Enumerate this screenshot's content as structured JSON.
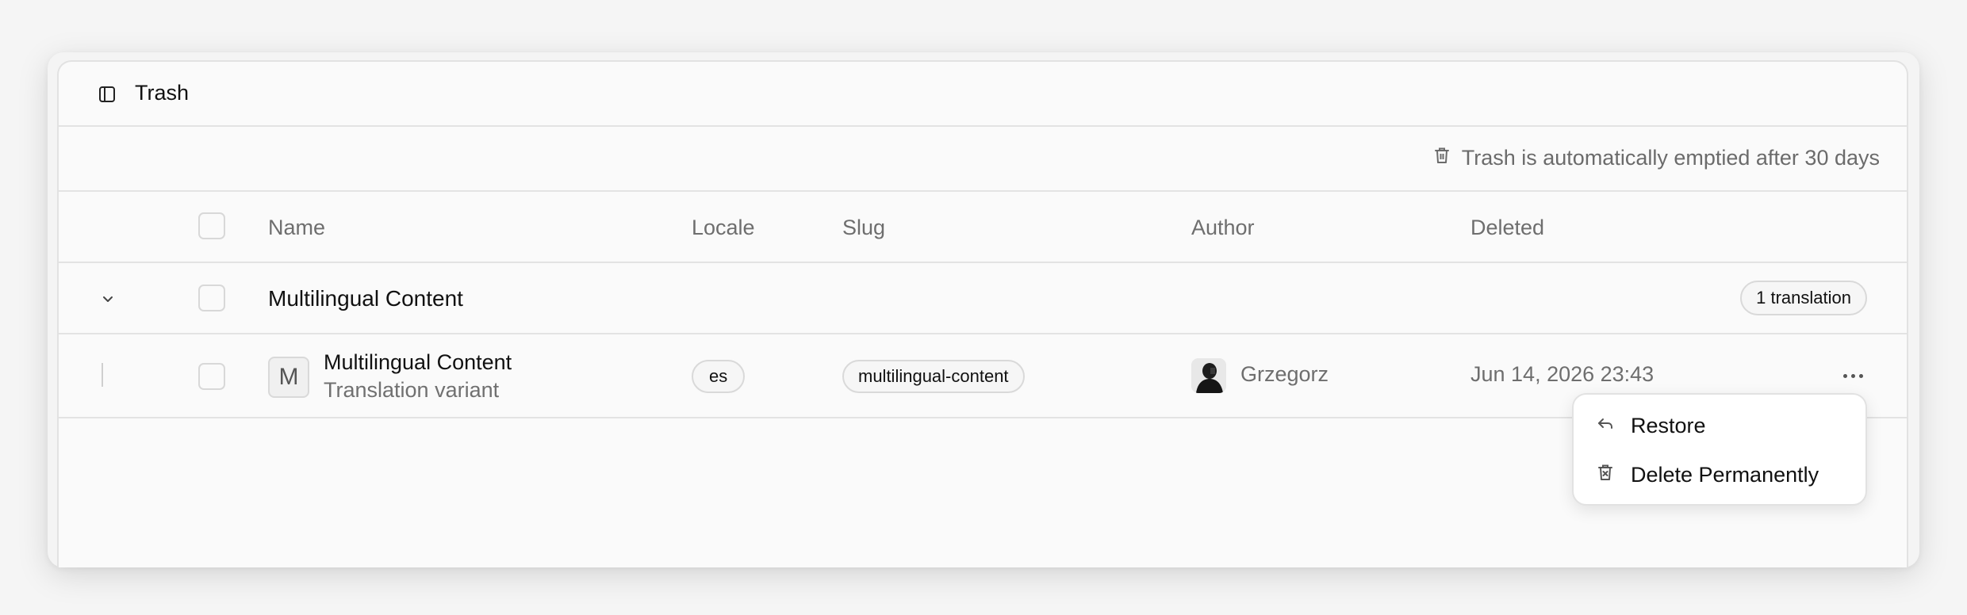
{
  "header": {
    "title": "Trash"
  },
  "notice": {
    "text": "Trash is automatically emptied after 30 days"
  },
  "table": {
    "columns": [
      "Name",
      "Locale",
      "Slug",
      "Author",
      "Deleted"
    ]
  },
  "group": {
    "name": "Multilingual Content",
    "badge": "1 translation"
  },
  "rows": [
    {
      "type_letter": "M",
      "title": "Multilingual Content",
      "subtitle": "Translation variant",
      "locale": "es",
      "slug": "multilingual-content",
      "author": "Grzegorz",
      "deleted": "Jun 14, 2026 23:43"
    }
  ],
  "context_menu": {
    "items": [
      {
        "label": "Restore",
        "icon": "undo-arrow-icon"
      },
      {
        "label": "Delete Permanently",
        "icon": "trash-x-icon"
      }
    ]
  }
}
